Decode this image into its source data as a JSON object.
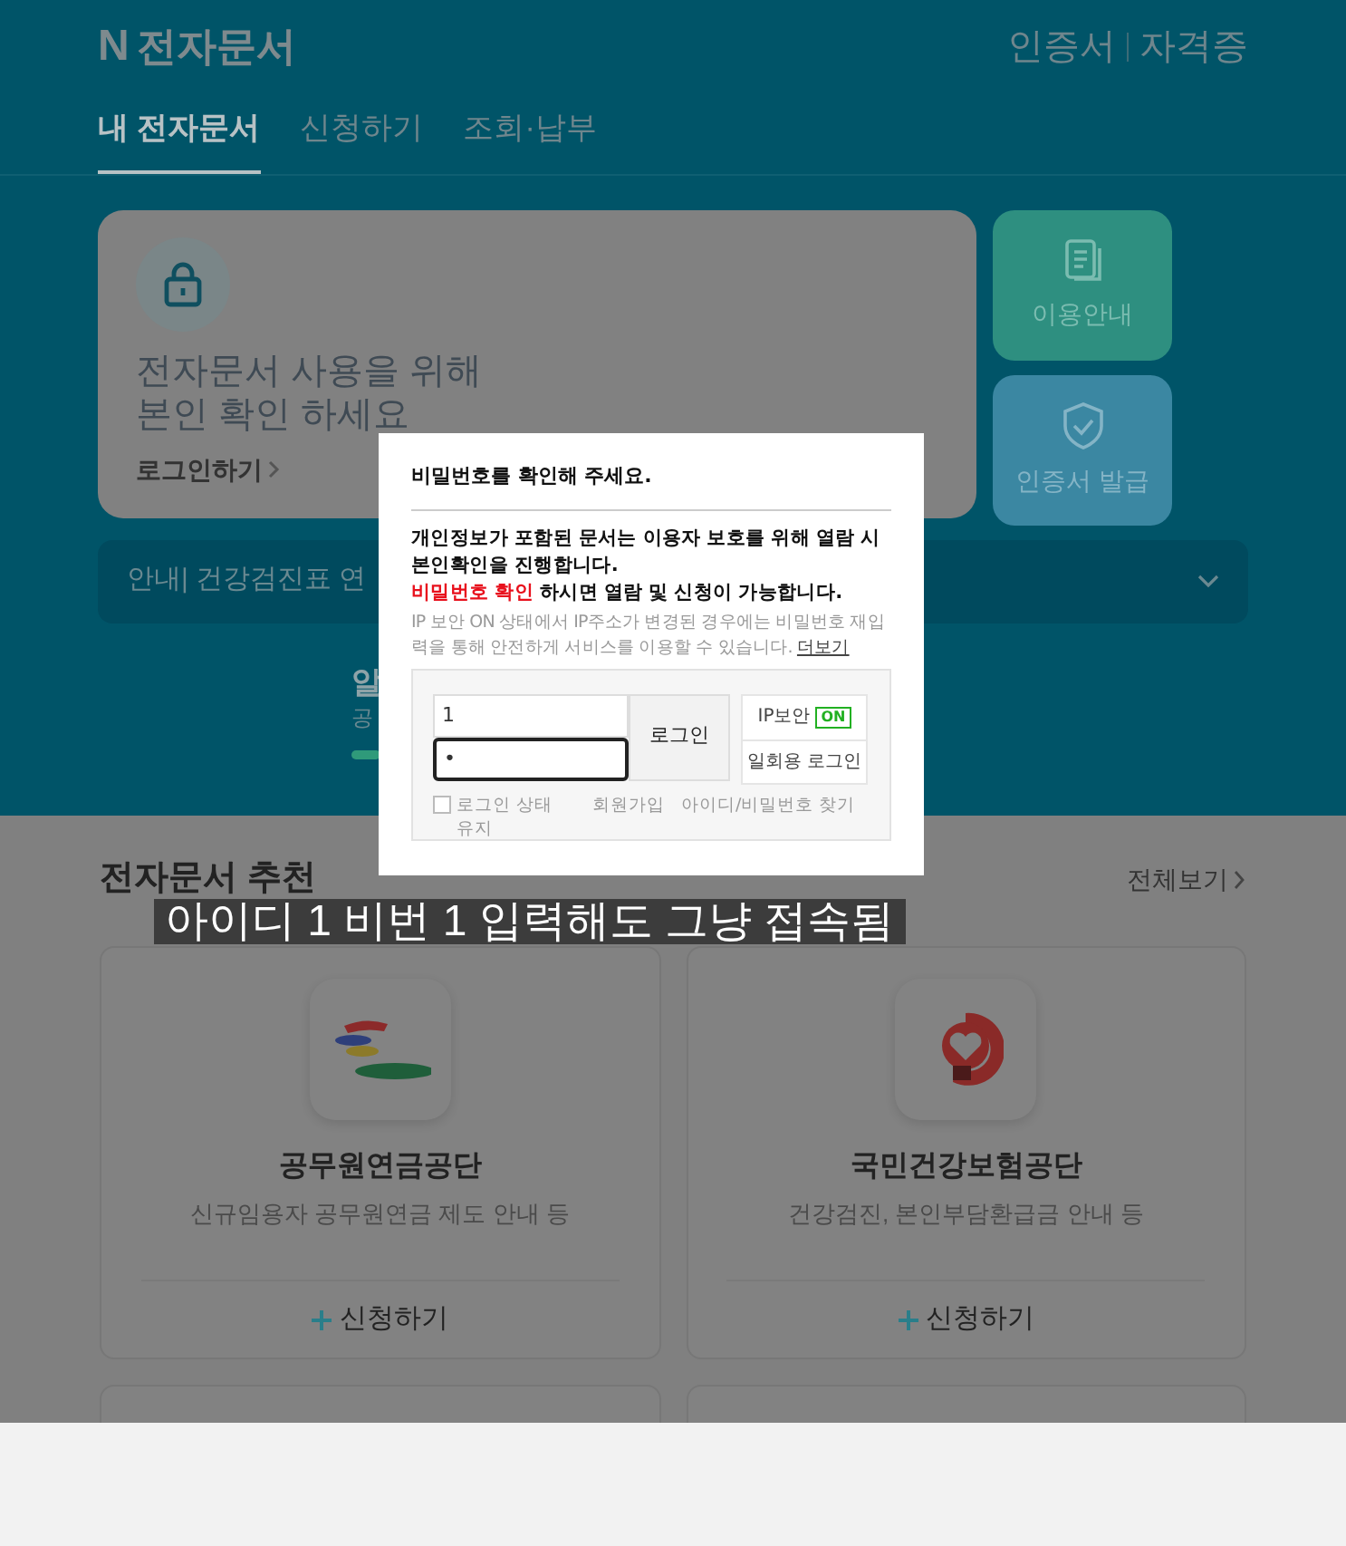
{
  "header": {
    "logo_mark": "N",
    "logo_text": "전자문서",
    "links": [
      "인증서",
      "자격증"
    ]
  },
  "tabs": [
    {
      "label": "내 전자문서",
      "selected": true
    },
    {
      "label": "신청하기",
      "selected": false
    },
    {
      "label": "조회·납부",
      "selected": false
    }
  ],
  "login_card": {
    "headline": [
      "전자문서 사용을 위해",
      "본인 확인 하세요"
    ],
    "link": "로그인하기"
  },
  "side_buttons": [
    "이용안내",
    "인증서 발급"
  ],
  "notice_bar": {
    "text": "안내| 건강검진표 연"
  },
  "hidden_block": {
    "title": "알",
    "subtitle": "공"
  },
  "recommend": {
    "title": "전자문서 추천",
    "view_all": "전체보기",
    "cards": [
      {
        "name": "공무원연금공단",
        "description": "신규임용자 공무원연금 제도 안내 등",
        "action": "신청하기"
      },
      {
        "name": "국민건강보험공단",
        "description": "건강검진, 본인부담환급금 안내 등",
        "action": "신청하기"
      }
    ]
  },
  "dialog": {
    "title": "비밀번호를 확인해 주세요.",
    "notice": "개인정보가 포함된 문서는 이용자 보호를 위해 열람 시 본인확인을 진행합니다.",
    "highlight": "비밀번호 확인",
    "highlight_rest": " 하시면 열람 및 신청이 가능합니다.",
    "note": "IP 보안 ON 상태에서 IP주소가 변경된 경우에는 비밀번호 재입력을 통해 안전하게 서비스를 이용할 수 있습니다.",
    "more_link": "더보기",
    "id_value": "1",
    "password_value": "•",
    "login_button": "로그인",
    "ip_security": {
      "label": "IP보안",
      "badge": "ON",
      "on": true
    },
    "otp_button": "일회용 로그인",
    "keep_login": {
      "label": "로그인 상태 유지",
      "checked": false
    },
    "links": [
      "회원가입",
      "아이디/비밀번호 찾기"
    ]
  },
  "caption": "아이디 1 비번 1 입력해도 그냥 접속됨"
}
